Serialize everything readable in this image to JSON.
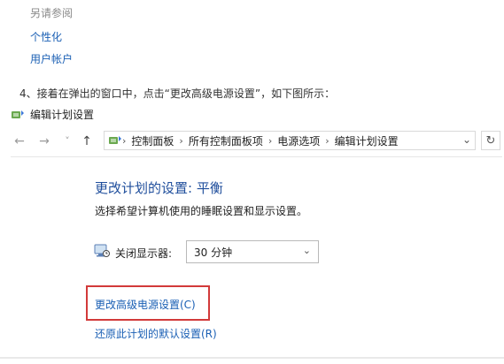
{
  "see_also": {
    "title": "另请参阅",
    "links": [
      "个性化",
      "用户帐户"
    ]
  },
  "step_text": "4、接着在弹出的窗口中，点击“更改高级电源设置”，如下图所示：",
  "window": {
    "title": "编辑计划设置"
  },
  "nav": {
    "back": "←",
    "forward": "→",
    "history": "˅",
    "up": "↑",
    "breadcrumb": [
      "控制面板",
      "所有控制面板项",
      "电源选项",
      "编辑计划设置"
    ],
    "refresh_icon": "↻"
  },
  "plan": {
    "heading": "更改计划的设置: 平衡",
    "subtext": "选择希望计算机使用的睡眠设置和显示设置。",
    "display_off_label": "关闭显示器:",
    "display_off_value": "30 分钟",
    "advanced_link": "更改高级电源设置(C)",
    "restore_link": "还原此计划的默认设置(R)"
  },
  "colors": {
    "link": "#1a5fb4",
    "heading": "#1f4e9c",
    "highlight": "#d23a3a"
  }
}
